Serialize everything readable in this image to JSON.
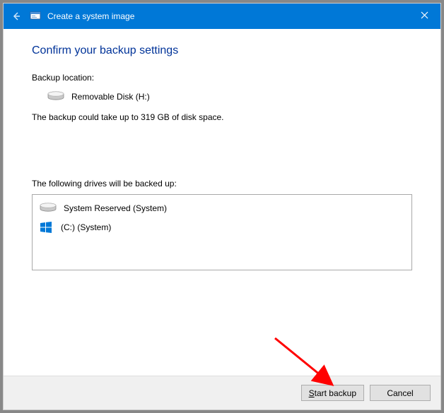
{
  "titlebar": {
    "title": "Create a system image"
  },
  "heading": "Confirm your backup settings",
  "backup_location_label": "Backup location:",
  "backup_location_value": "Removable Disk (H:)",
  "space_note": "The backup could take up to 319 GB of disk space.",
  "drives_label": "The following drives will be backed up:",
  "drives": [
    {
      "icon": "hdd",
      "label": "System Reserved (System)"
    },
    {
      "icon": "windows",
      "label": "(C:) (System)"
    }
  ],
  "buttons": {
    "start_prefix": "S",
    "start_rest": "tart backup",
    "cancel": "Cancel"
  }
}
